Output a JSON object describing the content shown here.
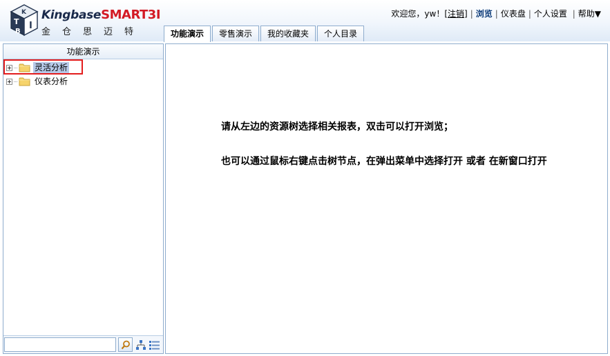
{
  "app": {
    "brand_prefix": "Kingbase",
    "brand_suffix": "SMART3I",
    "brand_cn": "金仓思迈特",
    "logo_letters": "KTBI"
  },
  "userbar": {
    "welcome": "欢迎您，yw！",
    "logout": "注销",
    "browse": "浏览",
    "dashboard": "仪表盘",
    "settings": "个人设置",
    "help": "帮助▼"
  },
  "tabs": [
    {
      "label": "功能演示",
      "active": true
    },
    {
      "label": "零售演示",
      "active": false
    },
    {
      "label": "我的收藏夹",
      "active": false
    },
    {
      "label": "个人目录",
      "active": false
    }
  ],
  "left_panel": {
    "title": "功能演示",
    "tree": [
      {
        "label": "灵活分析",
        "selected": true
      },
      {
        "label": "仪表分析",
        "selected": false
      }
    ],
    "search": {
      "value": "",
      "placeholder": ""
    }
  },
  "main": {
    "hint_line1": "请从左边的资源树选择相关报表，双击可以打开浏览；",
    "hint_line2": "也可以通过鼠标右键点击树节点，在弹出菜单中选择打开 或者 在新窗口打开"
  },
  "colors": {
    "accent": "#0b3a78",
    "border": "#8eaccd",
    "highlight": "#e31c1c",
    "selection": "#b7c9e8",
    "brand_red": "#d31a24"
  }
}
